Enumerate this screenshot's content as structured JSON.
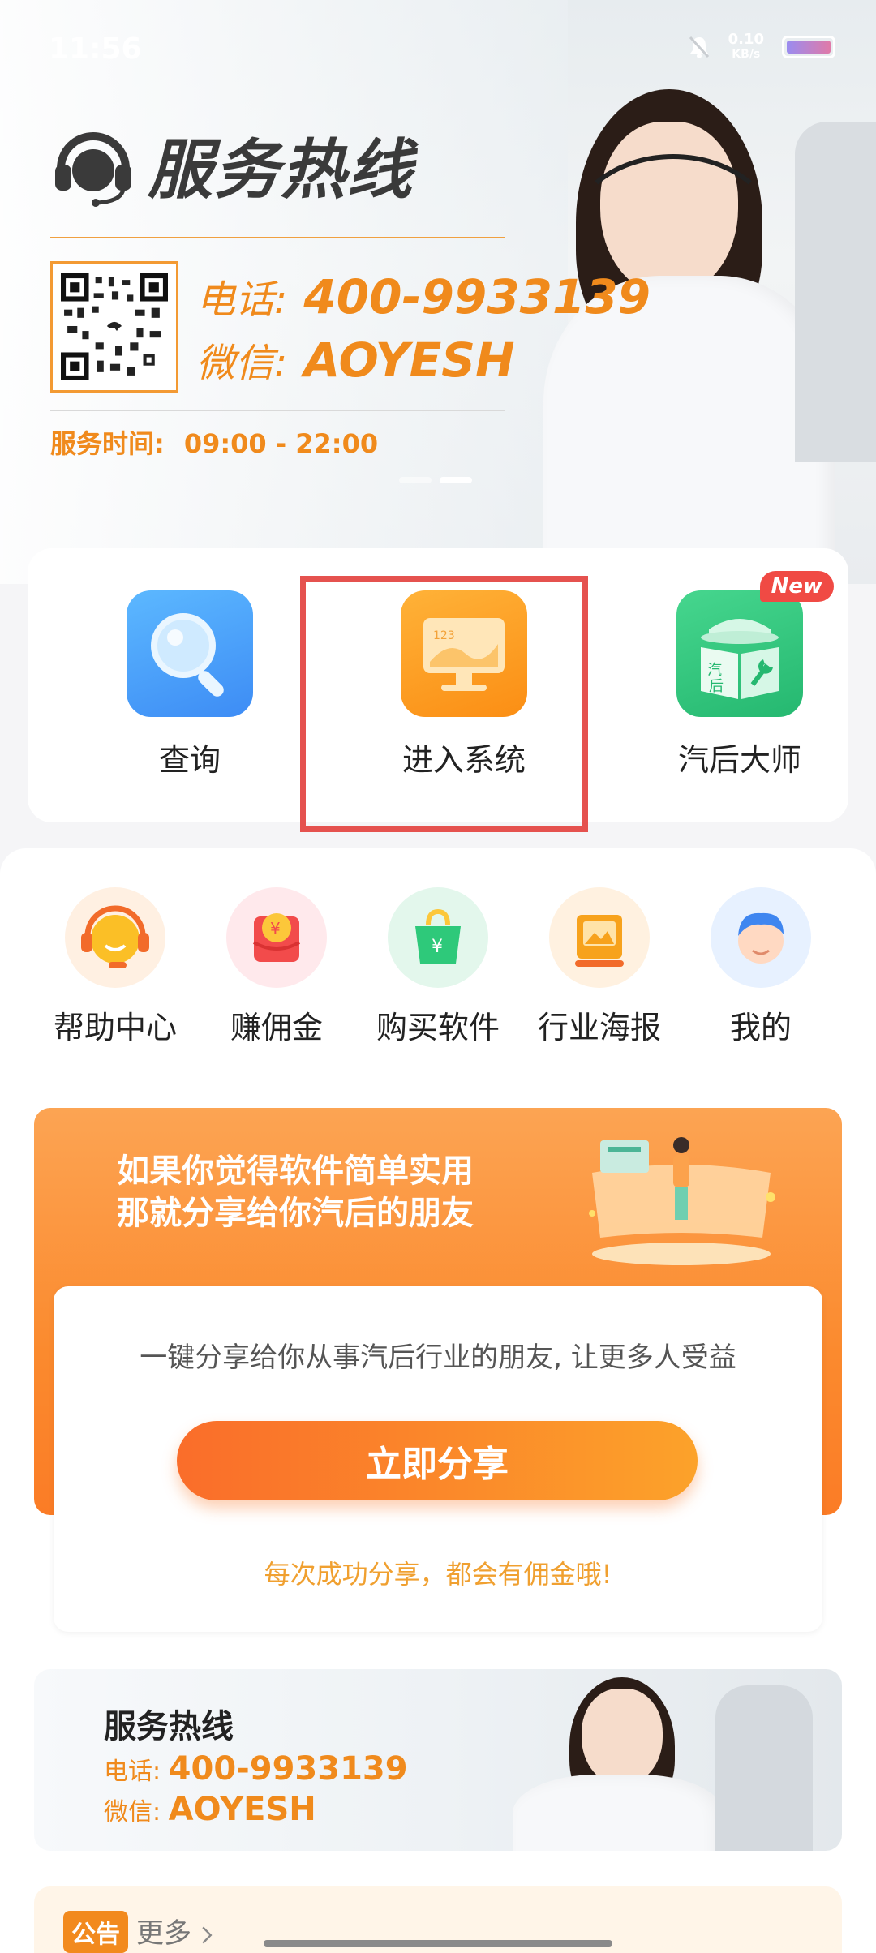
{
  "status_bar": {
    "time": "11:56",
    "net_speed_value": "0.10",
    "net_speed_unit": "KB/s"
  },
  "hero": {
    "title": "服务热线",
    "phone_label": "电话:",
    "phone": "400-9933139",
    "wechat_label": "微信:",
    "wechat": "AOYESH",
    "hours_label": "服务时间:",
    "hours": "09:00 - 22:00"
  },
  "main_actions": [
    {
      "label": "查询",
      "icon": "magnifier-icon",
      "color": "#4aa8ff"
    },
    {
      "label": "进入系统",
      "icon": "monitor-icon",
      "color": "#fca022"
    },
    {
      "label": "汽后大师",
      "icon": "auto-master-icon",
      "color": "#2ec980",
      "badge": "New"
    }
  ],
  "secondary_actions": [
    {
      "label": "帮助中心",
      "icon": "headset-support-icon"
    },
    {
      "label": "赚佣金",
      "icon": "red-envelope-icon"
    },
    {
      "label": "购买软件",
      "icon": "shopping-bag-icon"
    },
    {
      "label": "行业海报",
      "icon": "poster-icon"
    },
    {
      "label": "我的",
      "icon": "avatar-icon"
    }
  ],
  "share": {
    "headline_line1": "如果你觉得软件简单实用",
    "headline_line2": "那就分享给你汽后的朋友",
    "description": "一键分享给你从事汽后行业的朋友, 让更多人受益",
    "button": "立即分享",
    "note": "每次成功分享，都会有佣金哦!"
  },
  "hotline": {
    "title": "服务热线",
    "phone_label": "电话:",
    "phone": "400-9933139",
    "wechat_label": "微信:",
    "wechat": "AOYESH"
  },
  "notice": {
    "badge": "公告",
    "more": "更多"
  },
  "colors": {
    "accent": "#f08a1c",
    "highlight": "#e5524f"
  }
}
